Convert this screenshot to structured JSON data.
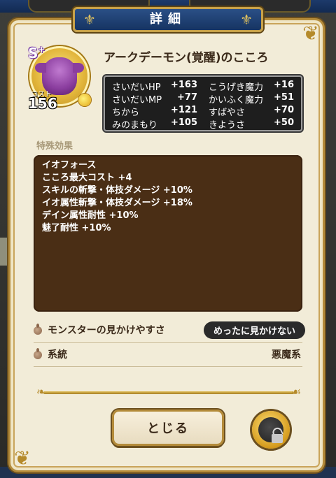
{
  "dialog": {
    "title": "詳細",
    "close_label": "とじる"
  },
  "heart": {
    "rank": "S",
    "rank_plus": "+",
    "cost_label": "コスト",
    "cost": "156",
    "name": "アークデーモン(覚醒)のこころ"
  },
  "stats": [
    {
      "label": "さいだいHP",
      "value": "+163",
      "label2": "こうげき魔力",
      "value2": "+16"
    },
    {
      "label": "さいだいMP",
      "value": "+77",
      "label2": "かいふく魔力",
      "value2": "+51"
    },
    {
      "label": "ちから",
      "value": "+121",
      "label2": "すばやさ",
      "value2": "+70"
    },
    {
      "label": "みのまもり",
      "value": "+105",
      "label2": "きようさ",
      "value2": "+50"
    }
  ],
  "effects": {
    "section_label": "特殊効果",
    "lines": [
      "イオフォース",
      "こころ最大コスト +4",
      "スキルの斬撃・体技ダメージ +10%",
      "イオ属性斬撃・体技ダメージ +18%",
      "デイン属性耐性 +10%",
      "魅了耐性 +10%"
    ]
  },
  "info": {
    "rarity_label": "モンスターの見かけやすさ",
    "rarity_value": "めったに見かけない",
    "family_label": "系統",
    "family_value": "悪魔系"
  },
  "colors": {
    "accent_gold": "#b48b3a",
    "banner_blue": "#1f4278",
    "effects_bg": "#4a2e15"
  }
}
